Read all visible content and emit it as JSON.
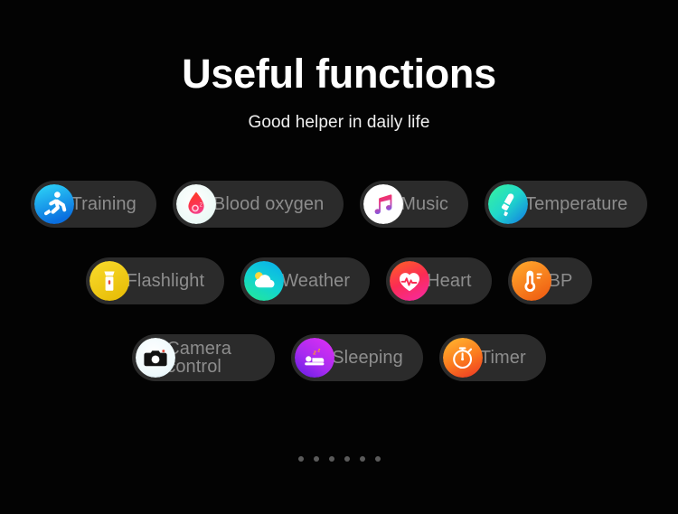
{
  "header": {
    "title": "Useful functions",
    "subtitle": "Good helper in daily life"
  },
  "colors": {
    "background": "#030303",
    "chip_background": "#2b2b2b",
    "chip_label": "#8d8d8d",
    "title": "#ffffff",
    "subtitle": "#f0f0f0",
    "dot": "#5a5a5a"
  },
  "rows": [
    {
      "items": [
        {
          "label": "Training",
          "icon": "running-person-icon",
          "icon_colors": [
            "#2ad4f5",
            "#0a7de8"
          ]
        },
        {
          "label": "Blood oxygen",
          "icon": "blood-drop-o2-icon",
          "icon_colors": [
            "#eaf7f4",
            "#ffffff"
          ]
        },
        {
          "label": "Music",
          "icon": "music-note-icon",
          "icon_colors": [
            "#ffffff",
            "#f4f4f6"
          ]
        },
        {
          "label": "Temperature",
          "icon": "infrared-thermometer-icon",
          "icon_colors": [
            "#2fe6a8",
            "#19a7e0"
          ]
        }
      ]
    },
    {
      "items": [
        {
          "label": "Flashlight",
          "icon": "flashlight-icon",
          "icon_colors": [
            "#f5d116",
            "#e9c10d"
          ]
        },
        {
          "label": "Weather",
          "icon": "sun-cloud-icon",
          "icon_colors": [
            "#0fd0e6",
            "#1fe2a0"
          ]
        },
        {
          "label": "Heart",
          "icon": "heart-pulse-icon",
          "icon_colors": [
            "#ff4d3d",
            "#ff2e86"
          ]
        },
        {
          "label": "BP",
          "icon": "thermometer-gauge-icon",
          "icon_colors": [
            "#ff9a1f",
            "#f2650d"
          ]
        }
      ]
    },
    {
      "items": [
        {
          "label": "Camera control",
          "icon": "camera-icon",
          "icon_colors": [
            "#e9f7fb",
            "#ffffff"
          ],
          "two_line": true
        },
        {
          "label": "Sleeping",
          "icon": "bed-sleep-icon",
          "icon_colors": [
            "#c22ff0",
            "#7a21e8"
          ]
        },
        {
          "label": "Timer",
          "icon": "stopwatch-icon",
          "icon_colors": [
            "#ffa32b",
            "#f04a23"
          ]
        }
      ]
    }
  ],
  "pagination": {
    "count": 6,
    "active_index": null
  }
}
